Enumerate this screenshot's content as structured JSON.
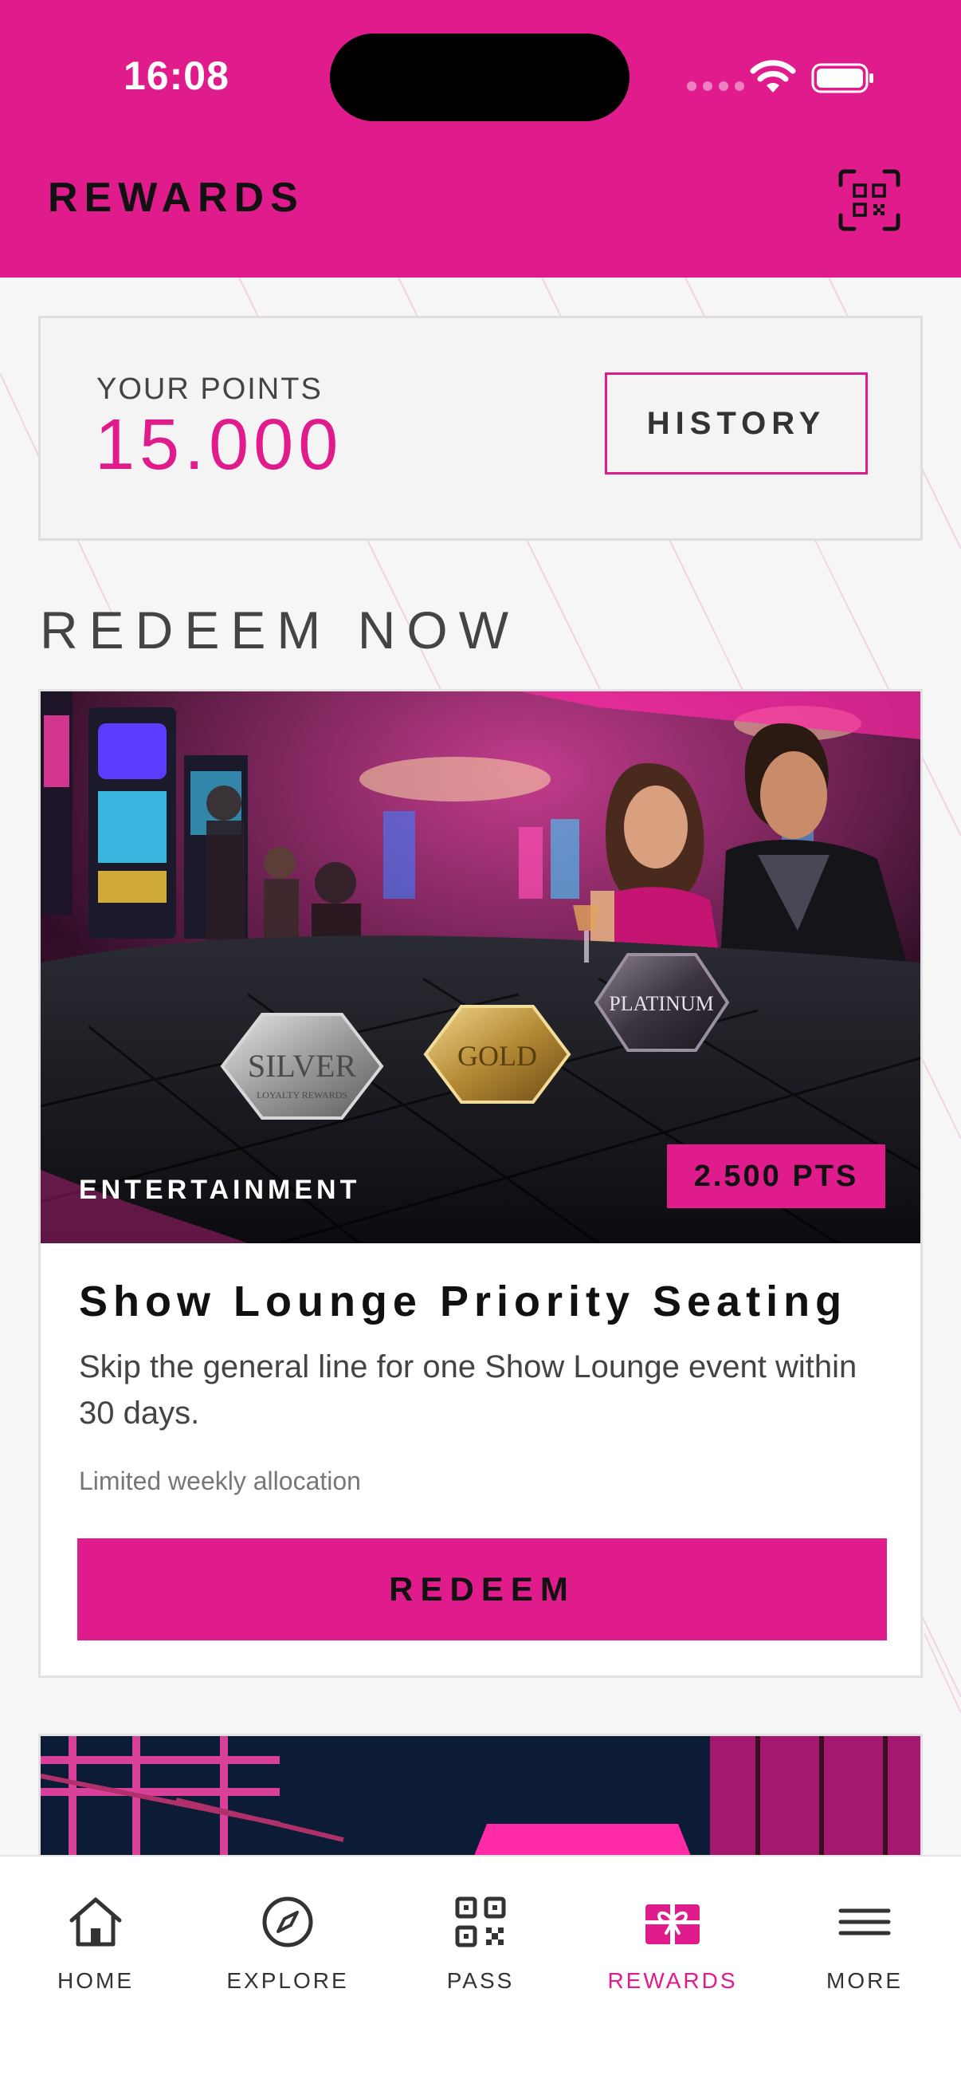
{
  "status_bar": {
    "time": "16:08"
  },
  "header": {
    "title": "REWARDS"
  },
  "points": {
    "label": "YOUR POINTS",
    "value": "15.000",
    "history_label": "HISTORY"
  },
  "section": {
    "title": "REDEEM NOW"
  },
  "reward": {
    "category": "ENTERTAINMENT",
    "points": "2.500 PTS",
    "title": "Show Lounge Priority Seating",
    "description": "Skip the general line for one Show Lounge event within 30 days.",
    "note": "Limited weekly allocation",
    "redeem_label": "REDEEM",
    "image_labels": {
      "silver": "SILVER",
      "silver_sub": "LOYALTY REWARDS",
      "gold": "GOLD",
      "platinum": "PLATINUM"
    }
  },
  "nav": {
    "items": [
      {
        "label": "HOME",
        "icon": "home-icon"
      },
      {
        "label": "EXPLORE",
        "icon": "compass-icon"
      },
      {
        "label": "PASS",
        "icon": "qr-icon"
      },
      {
        "label": "REWARDS",
        "icon": "gift-icon"
      },
      {
        "label": "MORE",
        "icon": "menu-icon"
      }
    ]
  },
  "colors": {
    "accent": "#e01b8c",
    "text_dark": "#111111"
  }
}
